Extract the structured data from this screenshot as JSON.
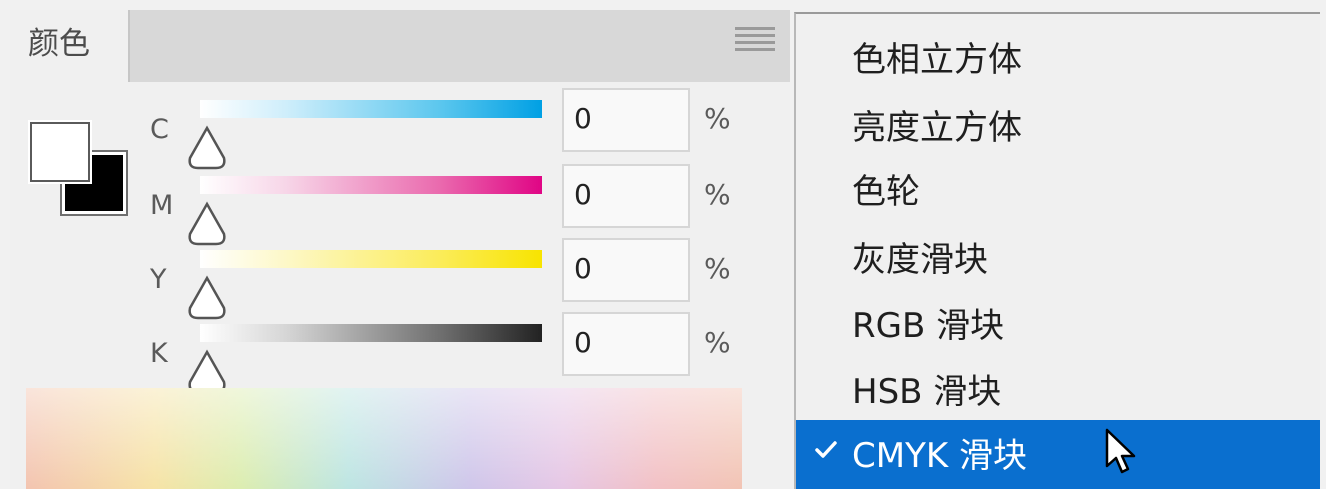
{
  "panel": {
    "tab_label": "颜色",
    "menu_icon": "hamburger-icon",
    "sliders": [
      {
        "channel": "C",
        "value": "0",
        "unit": "%",
        "color": "#00a0e4"
      },
      {
        "channel": "M",
        "value": "0",
        "unit": "%",
        "color": "#e00585"
      },
      {
        "channel": "Y",
        "value": "0",
        "unit": "%",
        "color": "#f8e400"
      },
      {
        "channel": "K",
        "value": "0",
        "unit": "%",
        "color": "#222222"
      }
    ],
    "foreground_color": "#ffffff",
    "background_color": "#000000"
  },
  "menu": {
    "items": [
      {
        "label": "色相立方体"
      },
      {
        "label": "亮度立方体"
      },
      {
        "label": "色轮"
      },
      {
        "label": "灰度滑块"
      },
      {
        "label": "RGB 滑块"
      },
      {
        "label": "HSB 滑块"
      },
      {
        "label": "CMYK 滑块",
        "selected": true,
        "icon": "checkmark-icon"
      }
    ],
    "selected_color": "#0a6fcf"
  }
}
